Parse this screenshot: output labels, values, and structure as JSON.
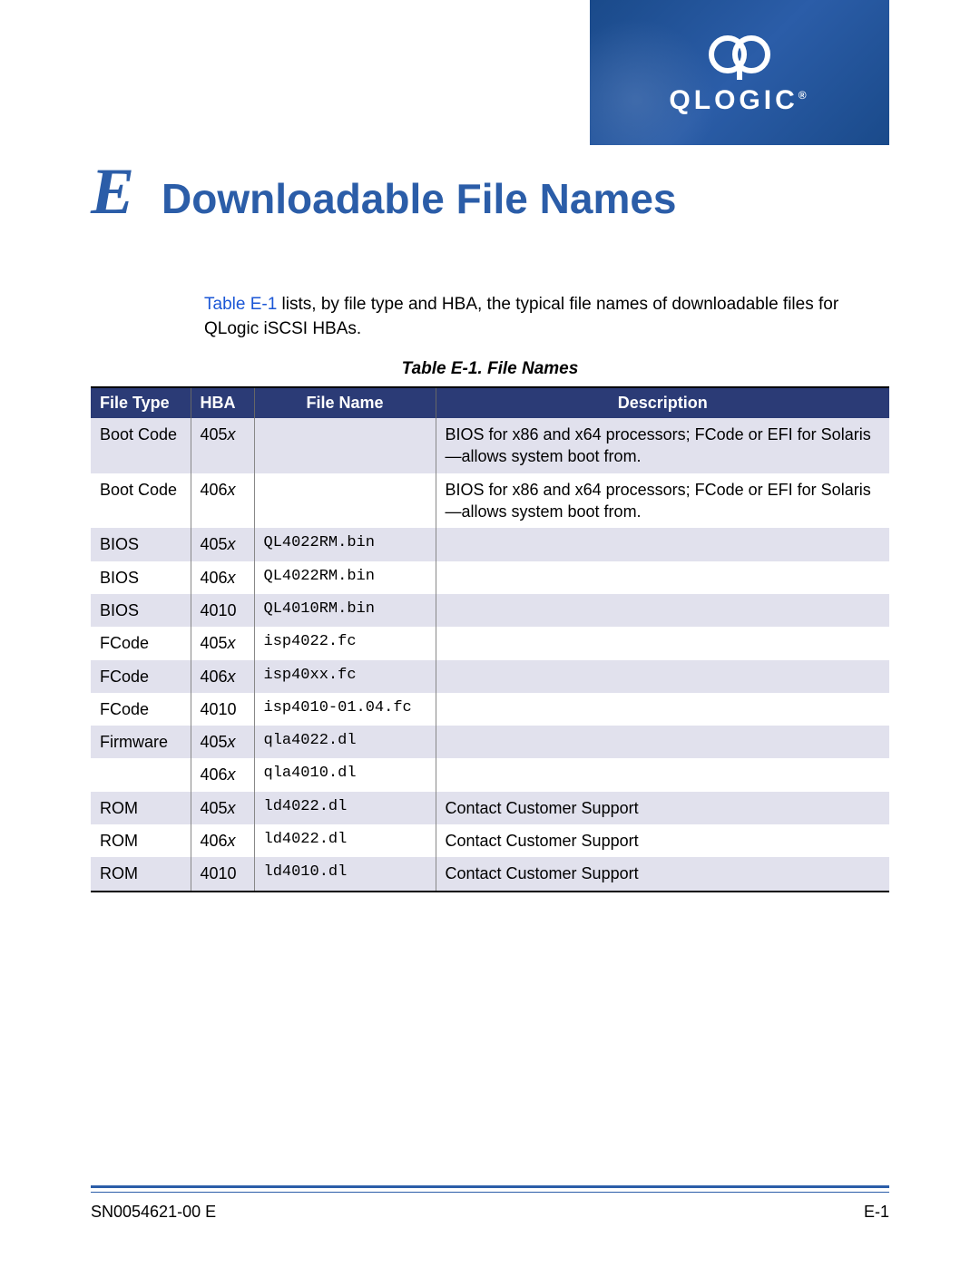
{
  "brand": {
    "name": "QLOGIC"
  },
  "appendix_letter": "E",
  "page_title": "Downloadable File Names",
  "intro": {
    "link": "Table E-1",
    "rest": " lists, by file type and HBA, the typical file names of downloadable files for QLogic iSCSI HBAs."
  },
  "table": {
    "caption": "Table E-1. File Names",
    "headers": {
      "filetype": "File Type",
      "hba": "HBA",
      "filename": "File Name",
      "description": "Description"
    },
    "rows": [
      {
        "filetype": "Boot Code",
        "hba_prefix": "405",
        "hba_suffix": "x",
        "filename": "",
        "description": "BIOS for x86 and x64 processors; FCode or EFI for Solaris—allows system boot from."
      },
      {
        "filetype": "Boot Code",
        "hba_prefix": "406",
        "hba_suffix": "x",
        "filename": "",
        "description": "BIOS for x86 and x64 processors; FCode or EFI for Solaris—allows system boot from."
      },
      {
        "filetype": "BIOS",
        "hba_prefix": "405",
        "hba_suffix": "x",
        "filename": "QL4022RM.bin",
        "description": ""
      },
      {
        "filetype": "BIOS",
        "hba_prefix": "406",
        "hba_suffix": "x",
        "filename": "QL4022RM.bin",
        "description": ""
      },
      {
        "filetype": "BIOS",
        "hba_prefix": "4010",
        "hba_suffix": "",
        "filename": "QL4010RM.bin",
        "description": ""
      },
      {
        "filetype": "FCode",
        "hba_prefix": "405",
        "hba_suffix": "x",
        "filename": "isp4022.fc",
        "description": ""
      },
      {
        "filetype": "FCode",
        "hba_prefix": "406",
        "hba_suffix": "x",
        "filename": "isp40xx.fc",
        "description": ""
      },
      {
        "filetype": "FCode",
        "hba_prefix": "4010",
        "hba_suffix": "",
        "filename": "isp4010-01.04.fc",
        "description": ""
      },
      {
        "filetype": "Firmware",
        "hba_prefix": "405",
        "hba_suffix": "x",
        "filename": "qla4022.dl",
        "description": ""
      },
      {
        "filetype": "",
        "hba_prefix": "406",
        "hba_suffix": "x",
        "filename": "qla4010.dl",
        "description": ""
      },
      {
        "filetype": "ROM",
        "hba_prefix": "405",
        "hba_suffix": "x",
        "filename": "ld4022.dl",
        "description": "Contact Customer Support"
      },
      {
        "filetype": "ROM",
        "hba_prefix": "406",
        "hba_suffix": "x",
        "filename": "ld4022.dl",
        "description": "Contact Customer Support"
      },
      {
        "filetype": "ROM",
        "hba_prefix": "4010",
        "hba_suffix": "",
        "filename": "ld4010.dl",
        "description": "Contact Customer Support"
      }
    ]
  },
  "footer": {
    "left": "SN0054621-00  E",
    "right": "E-1"
  }
}
